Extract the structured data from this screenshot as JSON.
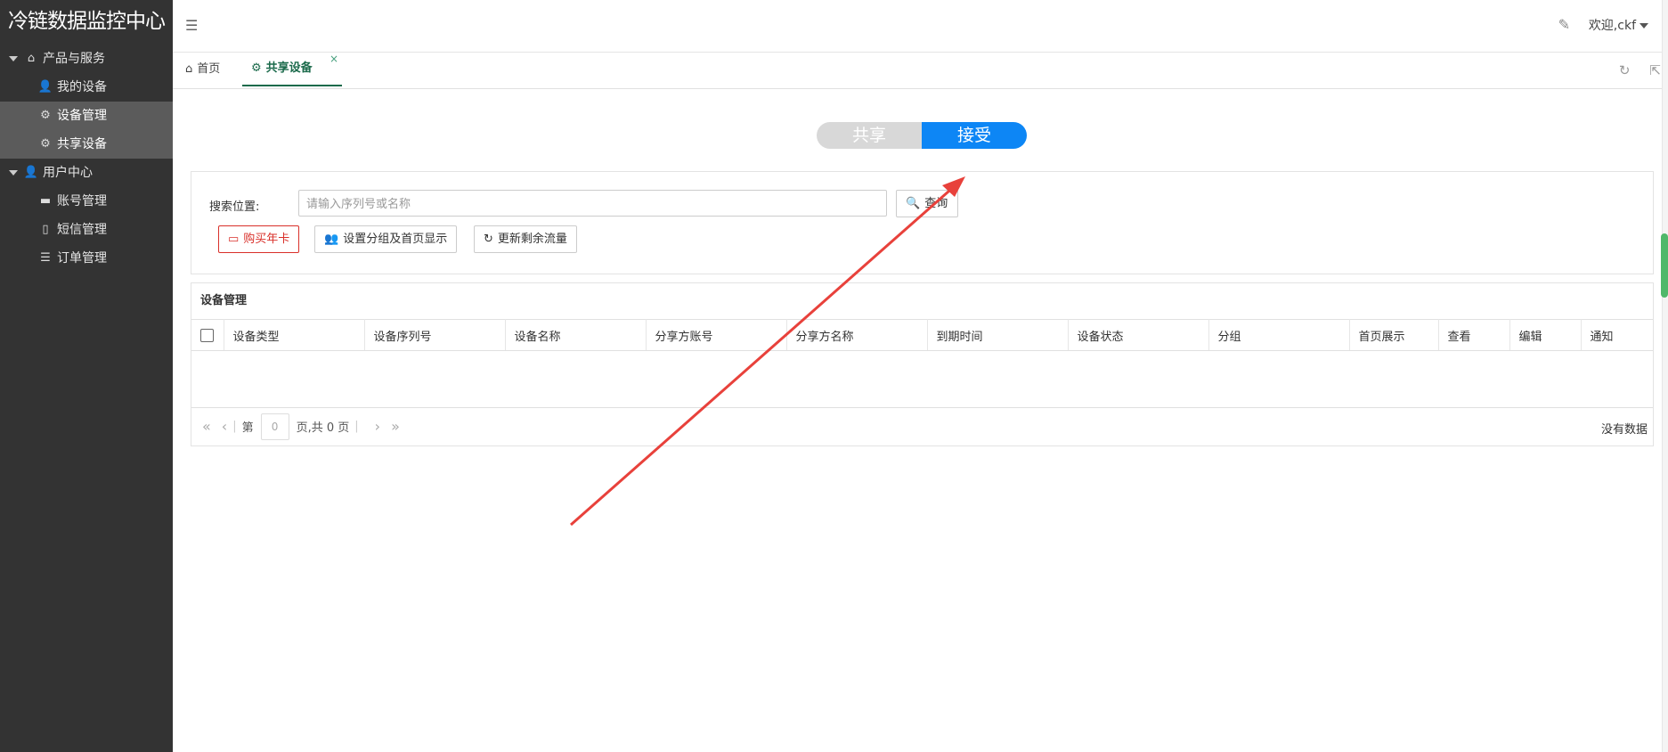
{
  "app": {
    "title": "冷链数据监控中心"
  },
  "sidebar": {
    "groups": [
      {
        "label": "产品与服务",
        "icon": "home-icon",
        "items": [
          {
            "label": "我的设备",
            "icon": "user-icon"
          },
          {
            "label": "设备管理",
            "icon": "gear-icon"
          },
          {
            "label": "共享设备",
            "icon": "gear-icon"
          }
        ]
      },
      {
        "label": "用户中心",
        "icon": "user-icon",
        "items": [
          {
            "label": "账号管理",
            "icon": "folder-icon"
          },
          {
            "label": "短信管理",
            "icon": "mobile-icon"
          },
          {
            "label": "订单管理",
            "icon": "list-icon"
          }
        ]
      }
    ]
  },
  "header": {
    "user_label": "欢迎,ckf"
  },
  "tabs": [
    {
      "label": "首页",
      "icon": "home-icon"
    },
    {
      "label": "共享设备",
      "icon": "gear-icon",
      "close": "×"
    }
  ],
  "toggle": {
    "share": "共享",
    "receive": "接受",
    "active": "receive"
  },
  "search": {
    "label": "搜索位置:",
    "placeholder": "请输入序列号或名称",
    "query_button": "查询",
    "buy_button": "购买年卡",
    "group_button": "设置分组及首页显示",
    "refresh_button": "更新剩余流量"
  },
  "table": {
    "title": "设备管理",
    "columns": [
      "设备类型",
      "设备序列号",
      "设备名称",
      "分享方账号",
      "分享方名称",
      "到期时间",
      "设备状态",
      "分组",
      "首页展示",
      "查看",
      "编辑",
      "通知"
    ]
  },
  "pager": {
    "prefix": "第",
    "page": "0",
    "suffix": "页,共 0 页",
    "no_data": "没有数据"
  },
  "colors": {
    "sidebar": "#333333",
    "accent": "#1b6a4b",
    "toggle_on": "#0d86f5",
    "toggle_off": "#d8d8d8",
    "danger": "#d9302a",
    "annotation": "#e8413b"
  }
}
